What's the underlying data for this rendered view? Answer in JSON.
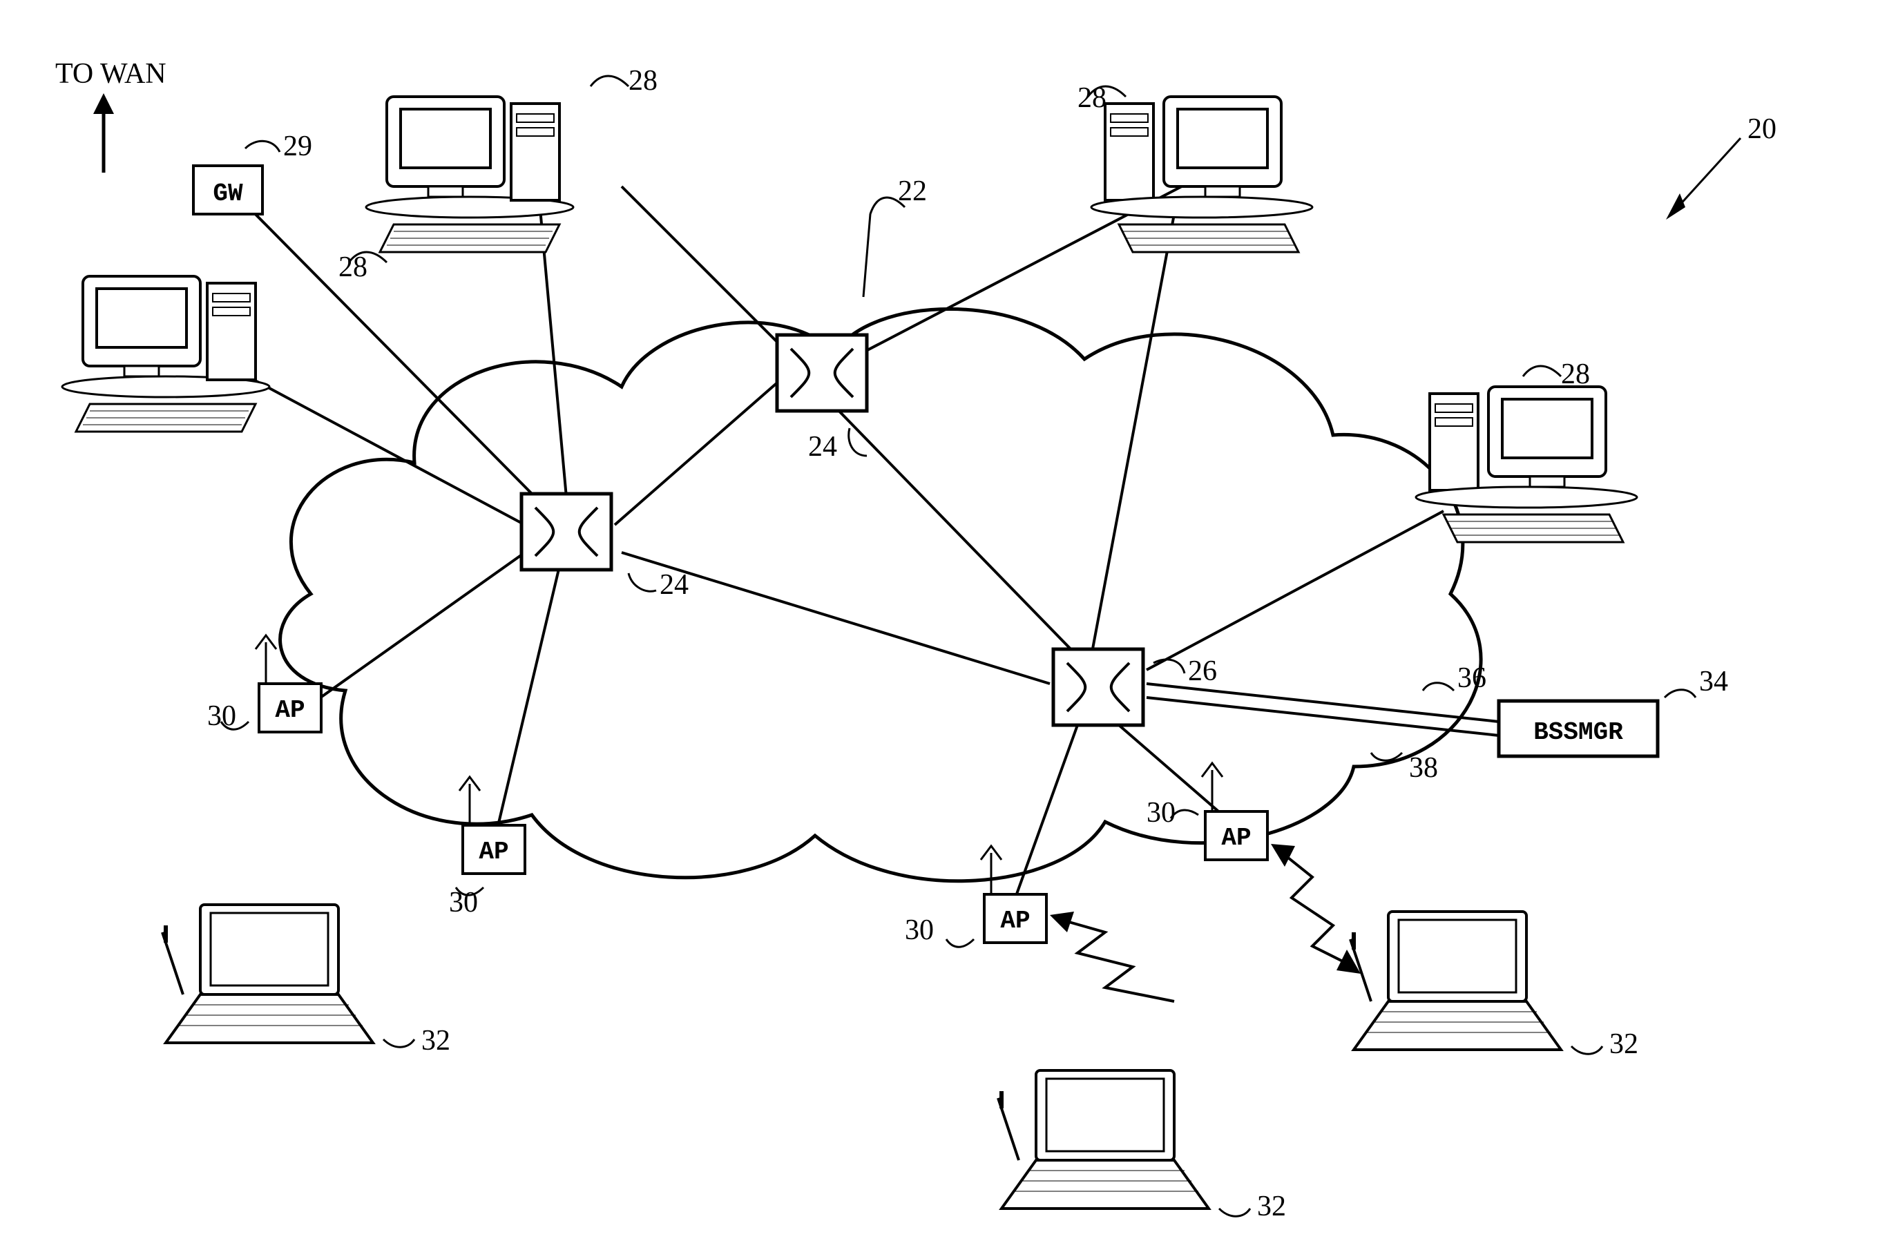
{
  "labels": {
    "to_wan": "TO  WAN",
    "gw": "GW",
    "ap": "AP",
    "bssmgr": "BSSMGR",
    "n20": "20",
    "n22": "22",
    "n24": "24",
    "n26": "26",
    "n28": "28",
    "n29": "29",
    "n30": "30",
    "n32": "32",
    "n34": "34",
    "n36": "36",
    "n38": "38"
  }
}
